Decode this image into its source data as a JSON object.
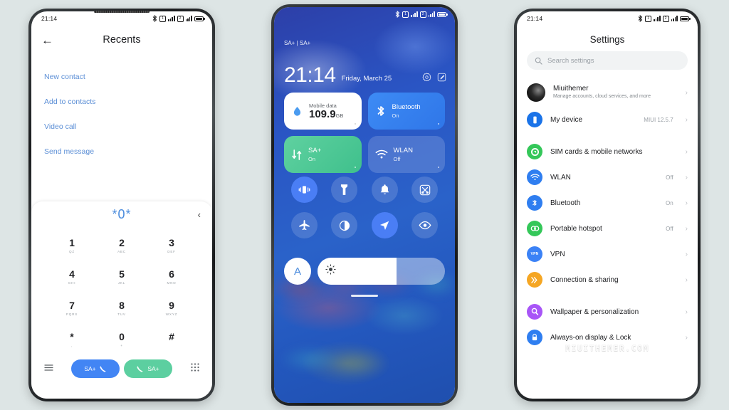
{
  "background_color": "#dde5e5",
  "status_bar": {
    "time": "21:14",
    "icons": [
      "bluetooth-icon",
      "sim1-icon",
      "signal-bars-icon",
      "sim2-icon",
      "signal-bars-icon",
      "battery-icon"
    ]
  },
  "left_phone": {
    "app": "Dialer",
    "header": {
      "back_icon": "arrow-left-icon",
      "title": "Recents"
    },
    "actions": [
      {
        "label": "New contact"
      },
      {
        "label": "Add to contacts"
      },
      {
        "label": "Video call"
      },
      {
        "label": "Send message"
      }
    ],
    "dialpad": {
      "number": "*0*",
      "collapse_icon": "chevron-left-icon",
      "keys": [
        {
          "num": "1",
          "sub": "QZ"
        },
        {
          "num": "2",
          "sub": "ABC"
        },
        {
          "num": "3",
          "sub": "DEF"
        },
        {
          "num": "4",
          "sub": "GHI"
        },
        {
          "num": "5",
          "sub": "JKL"
        },
        {
          "num": "6",
          "sub": "MNO"
        },
        {
          "num": "7",
          "sub": "PQRS"
        },
        {
          "num": "8",
          "sub": "TUV"
        },
        {
          "num": "9",
          "sub": "WXYZ"
        },
        {
          "num": "*",
          "sub": ","
        },
        {
          "num": "0",
          "sub": "+"
        },
        {
          "num": "#",
          "sub": ""
        }
      ],
      "left_icon": "list-icon",
      "right_icon": "keypad-grid-icon",
      "call_sim1": {
        "label": "SA+",
        "icon": "phone-icon",
        "color": "#4285f4"
      },
      "call_sim2": {
        "label": "SA+",
        "icon": "phone-icon",
        "color": "#5ccfa0"
      }
    },
    "link_color": "#5c8fd6"
  },
  "middle_phone": {
    "app": "Control center",
    "sim_label": "SA+ | SA+",
    "time": "21:14",
    "date": "Friday, March 25",
    "header_icons": [
      "settings-gear-icon",
      "edit-pencil-icon"
    ],
    "tiles": [
      {
        "name": "mobile-data",
        "label": "Mobile data",
        "value": "109.9",
        "unit": "GB",
        "icon": "data-drop-icon",
        "style": "white"
      },
      {
        "name": "bluetooth",
        "label": "Bluetooth",
        "status": "On",
        "icon": "bluetooth-icon",
        "style": "blue"
      },
      {
        "name": "sim-data",
        "label": "SA+",
        "status": "On",
        "icon": "data-arrows-icon",
        "style": "green"
      },
      {
        "name": "wlan",
        "label": "WLAN",
        "status": "Off",
        "icon": "wifi-icon",
        "style": "dim"
      }
    ],
    "toggles": [
      {
        "name": "vibrate",
        "icon": "vibrate-icon",
        "active": true
      },
      {
        "name": "flashlight",
        "icon": "flashlight-icon",
        "active": false
      },
      {
        "name": "ringtone",
        "icon": "bell-icon",
        "active": false
      },
      {
        "name": "screenshot",
        "icon": "screenshot-scissors-icon",
        "active": false
      },
      {
        "name": "airplane-mode",
        "icon": "airplane-icon",
        "active": false
      },
      {
        "name": "dark-mode",
        "icon": "contrast-half-circle-icon",
        "active": false
      },
      {
        "name": "location",
        "icon": "location-arrow-icon",
        "active": true
      },
      {
        "name": "reading-mode",
        "icon": "eye-icon",
        "active": false
      }
    ],
    "brightness": {
      "auto_label": "A",
      "icon": "sun-icon",
      "percent": 62
    }
  },
  "right_phone": {
    "app": "Settings",
    "title": "Settings",
    "search": {
      "placeholder": "Search settings",
      "icon": "search-icon"
    },
    "account": {
      "name": "Miuithemer",
      "subtitle": "Manage accounts, cloud services, and more",
      "avatar": "user-avatar",
      "chevron": "chevron-right-icon"
    },
    "device": {
      "label": "My device",
      "value": "MIUI 12.5.7",
      "icon": "phone-device-icon",
      "color": "#1a73e8"
    },
    "items": [
      {
        "label": "SIM cards & mobile networks",
        "value": "",
        "icon": "sim-card-icon",
        "color": "#34c759"
      },
      {
        "label": "WLAN",
        "value": "Off",
        "icon": "wifi-icon",
        "color": "#2f7ef0"
      },
      {
        "label": "Bluetooth",
        "value": "On",
        "icon": "bluetooth-icon",
        "color": "#2f7ef0"
      },
      {
        "label": "Portable hotspot",
        "value": "Off",
        "icon": "hotspot-icon",
        "color": "#34c759"
      },
      {
        "label": "VPN",
        "value": "",
        "icon": "vpn-icon",
        "color": "#3b82f6"
      },
      {
        "label": "Connection & sharing",
        "value": "",
        "icon": "connection-share-icon",
        "color": "#f5a623"
      },
      {
        "label": "Wallpaper & personalization",
        "value": "",
        "icon": "wallpaper-brush-icon",
        "color": "#a855f7"
      },
      {
        "label": "Always-on display & Lock",
        "value": "",
        "icon": "lock-icon",
        "color": "#2f7ef0"
      }
    ],
    "watermark": "MIUITHEMER.COM"
  }
}
